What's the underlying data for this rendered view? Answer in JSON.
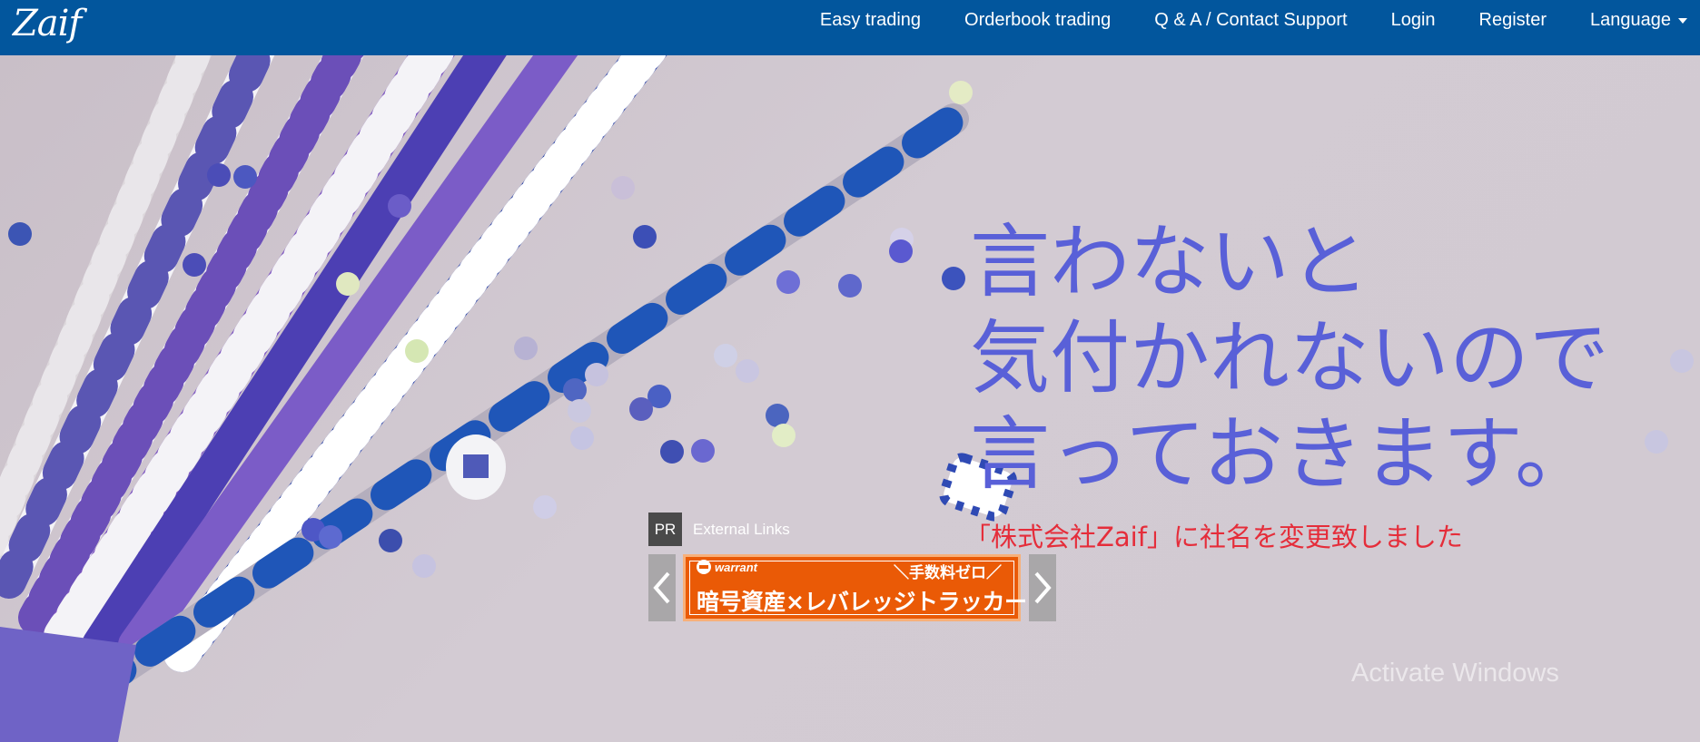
{
  "header": {
    "logo_text": "Zaif",
    "nav": [
      {
        "label": "Easy trading"
      },
      {
        "label": "Orderbook trading"
      },
      {
        "label": "Q & A / Contact Support"
      },
      {
        "label": "Login"
      },
      {
        "label": "Register"
      },
      {
        "label": "Language"
      }
    ],
    "bar_color": "#02569d"
  },
  "hero": {
    "headline_lines": [
      "言わないと",
      "気付かれないので",
      "言っておきます。"
    ],
    "subline": "「株式会社Zaif」に社名を変更致しました",
    "headline_color": "#5960d8",
    "subline_color": "#e52d3a"
  },
  "ad": {
    "badge": "PR",
    "label": "External Links",
    "banner": {
      "brand": "warrant",
      "tagline": "＼手数料ゼロ／",
      "main_text": "暗号資産×レバレッジトラッカー",
      "color": "#ea5a06"
    },
    "prev_icon": "chevron-left-icon",
    "next_icon": "chevron-right-icon"
  },
  "overlay": {
    "watermark": "Activate Windows"
  }
}
